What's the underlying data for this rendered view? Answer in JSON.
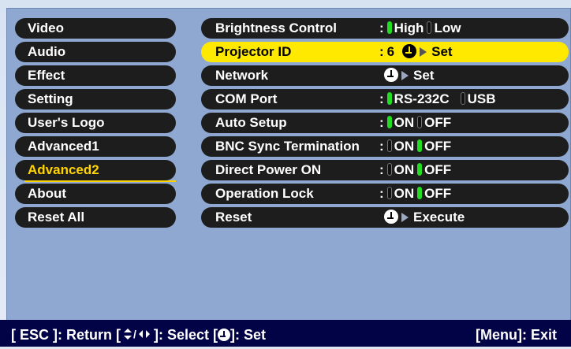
{
  "left_menu": [
    {
      "label": "Video",
      "active": false
    },
    {
      "label": "Audio",
      "active": false
    },
    {
      "label": "Effect",
      "active": false
    },
    {
      "label": "Setting",
      "active": false
    },
    {
      "label": "User's Logo",
      "active": false
    },
    {
      "label": "Advanced1",
      "active": false
    },
    {
      "label": "Advanced2",
      "active": true
    },
    {
      "label": "About",
      "active": false
    },
    {
      "label": "Reset All",
      "active": false
    }
  ],
  "rows": [
    {
      "label": "Brightness Control",
      "colon": ":",
      "opt1": "High",
      "opt2": "Low",
      "opt1_on": true
    },
    {
      "label": "Projector ID",
      "colon": ":",
      "value": "6",
      "action": "Set",
      "highlight": true
    },
    {
      "label": "Network",
      "action": "Set"
    },
    {
      "label": "COM Port",
      "colon": ":",
      "opt1": "RS-232C",
      "opt2": "USB",
      "opt1_on": true
    },
    {
      "label": "Auto Setup",
      "colon": ":",
      "opt1": "ON",
      "opt2": "OFF",
      "opt1_on": true
    },
    {
      "label": "BNC Sync Termination",
      "colon": ":",
      "opt1": "ON",
      "opt2": "OFF",
      "opt1_on": false
    },
    {
      "label": "Direct Power ON",
      "colon": ":",
      "opt1": "ON",
      "opt2": "OFF",
      "opt1_on": false
    },
    {
      "label": "Operation Lock",
      "colon": ":",
      "opt1": "ON",
      "opt2": "OFF",
      "opt1_on": false
    },
    {
      "label": "Reset",
      "action": "Execute"
    }
  ],
  "status": {
    "left_a": "[ ESC ]: Return  [",
    "left_b": "]: Select  [",
    "left_c": "]: Set",
    "right": "[Menu]: Exit"
  },
  "colors": {
    "accent": "#ffe900",
    "on": "#22dd22",
    "statusbar": "#020246"
  }
}
